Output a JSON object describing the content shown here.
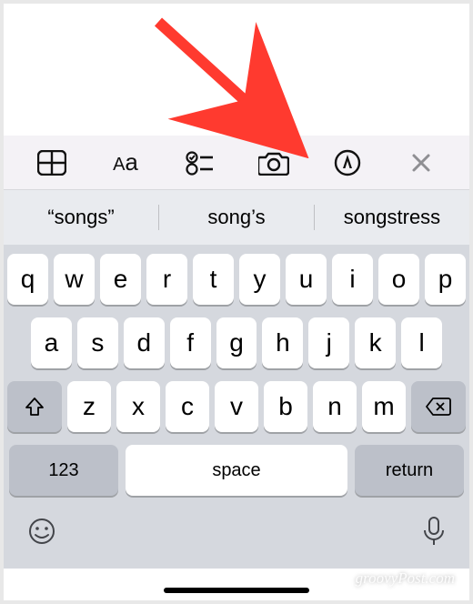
{
  "toolbar": {
    "table_icon": "table-icon",
    "text_format": "Aa",
    "checklist_icon": "checklist-icon",
    "camera_icon": "camera-icon",
    "markup_icon": "markup-icon",
    "close_icon": "close-icon"
  },
  "suggestions": [
    "“songs”",
    "song’s",
    "songstress"
  ],
  "keyboard": {
    "row1": [
      "q",
      "w",
      "e",
      "r",
      "t",
      "y",
      "u",
      "i",
      "o",
      "p"
    ],
    "row2": [
      "a",
      "s",
      "d",
      "f",
      "g",
      "h",
      "j",
      "k",
      "l"
    ],
    "row3": [
      "z",
      "x",
      "c",
      "v",
      "b",
      "n",
      "m"
    ],
    "numeric_label": "123",
    "space_label": "space",
    "return_label": "return"
  },
  "footer": {
    "emoji_icon": "emoji-icon",
    "mic_icon": "mic-icon"
  },
  "watermark": "groovyPost.com"
}
